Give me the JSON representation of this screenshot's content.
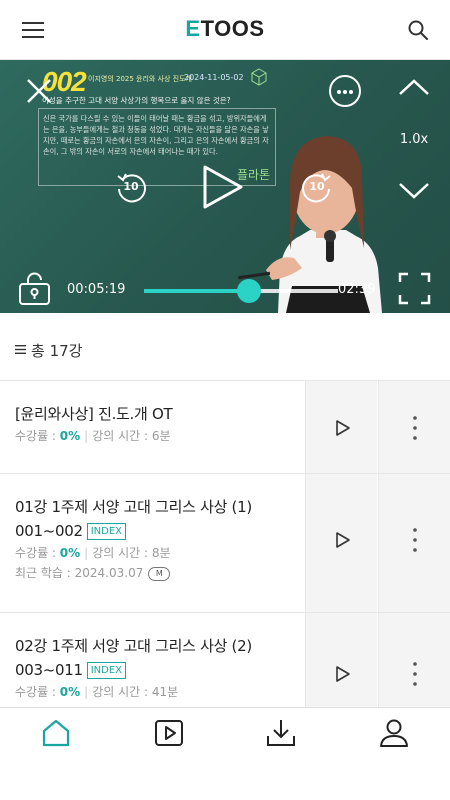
{
  "header": {
    "logo_first": "E",
    "logo_rest": "TOOS",
    "menu_icon": "hamburger-icon",
    "search_icon": "search-icon"
  },
  "player": {
    "board": {
      "number": "002",
      "subtitle": "이지영의 2025 윤리와 사상 진도개",
      "date": "2024-11-05-02",
      "question": "이성을 추구한 고대 서양 사상가의 행복으로 옳지 않은 것은?",
      "text": "신은 국가를 다스릴 수 있는 이들이 태어날 때는 황금을 섞고, 방위자들에게는 은을, 농부들에게는 철과 청동을 섞었다. 대개는 자신들을 닮은 자손을 낳지만, 때로는 황금의 자손에서 은의 자손이, 그리고 은의 자손에서 황금의 자손이, 그 밖의 자손이 서로의 자손에서 태어나는 때가 있다.",
      "badge": "플라톤"
    },
    "speed": "1.0x",
    "rewind_seconds": "10",
    "forward_seconds": "10",
    "current_time": "00:05:19",
    "end_time": "02:39",
    "progress": 0.54,
    "accent_color": "#2bd2c6"
  },
  "course_list": {
    "count_label": "총 17강",
    "items": [
      {
        "title": "[윤리와사상] 진.도.개 OT",
        "title_line2": "",
        "index_label": "",
        "rate_label": "수강률 : ",
        "rate": "0%",
        "duration_label": "강의 시간 : 6분",
        "recent_label": "",
        "recent_badge": ""
      },
      {
        "title": "01강 1주제 서양 고대 그리스 사상 (1)",
        "title_line2": "001~002",
        "index_label": "INDEX",
        "rate_label": "수강률 : ",
        "rate": "0%",
        "duration_label": "강의 시간 : 8분",
        "recent_label": "최근 학습 : 2024.03.07",
        "recent_badge": "M"
      },
      {
        "title": "02강 1주제 서양 고대 그리스 사상 (2)",
        "title_line2": "003~011",
        "index_label": "INDEX",
        "rate_label": "수강률 : ",
        "rate": "0%",
        "duration_label": "강의 시간 : 41분",
        "recent_label": "",
        "recent_badge": ""
      }
    ]
  },
  "bottom_nav": {
    "items": [
      "home-icon",
      "play-icon",
      "download-icon",
      "user-icon"
    ],
    "active_color": "#1aa6a0"
  }
}
